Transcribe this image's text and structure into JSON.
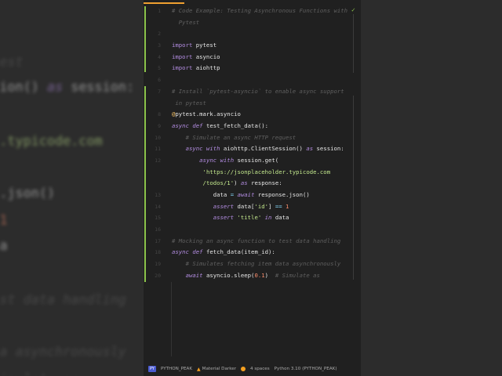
{
  "editor": {
    "lines": [
      {
        "n": "1",
        "t": [
          [
            "# Code Example: Testing Asynchronous Functions with",
            "c"
          ]
        ]
      },
      {
        "n": "",
        "t": [
          [
            "  Pytest",
            "c"
          ]
        ]
      },
      {
        "n": "2",
        "t": []
      },
      {
        "n": "3",
        "t": [
          [
            "import",
            "kw"
          ],
          [
            " pytest",
            ""
          ]
        ]
      },
      {
        "n": "4",
        "t": [
          [
            "import",
            "kw"
          ],
          [
            " asyncio",
            ""
          ]
        ]
      },
      {
        "n": "5",
        "t": [
          [
            "import",
            "kw"
          ],
          [
            " aiohttp",
            ""
          ]
        ]
      },
      {
        "n": "6",
        "t": []
      },
      {
        "n": "7",
        "t": [
          [
            "# Install `pytest-asyncio` to enable async support",
            "c"
          ]
        ]
      },
      {
        "n": "",
        "t": [
          [
            " in pytest",
            "c"
          ]
        ]
      },
      {
        "n": "8",
        "t": [
          [
            "@",
            "d"
          ],
          [
            "pytest.mark.asyncio",
            ""
          ]
        ]
      },
      {
        "n": "9",
        "t": [
          [
            "async def",
            "k"
          ],
          [
            " test_fetch_data():",
            ""
          ]
        ]
      },
      {
        "n": "10",
        "t": [
          [
            "    # Simulate an async HTTP request",
            "c"
          ]
        ]
      },
      {
        "n": "11",
        "t": [
          [
            "    ",
            ""
          ],
          [
            "async with",
            "k"
          ],
          [
            " aiohttp.ClientSession() ",
            ""
          ],
          [
            "as",
            "k"
          ],
          [
            " session:",
            ""
          ]
        ]
      },
      {
        "n": "12",
        "t": [
          [
            "        ",
            ""
          ],
          [
            "async with",
            "k"
          ],
          [
            " session.get(",
            ""
          ]
        ]
      },
      {
        "n": "",
        "t": [
          [
            "         ",
            ""
          ],
          [
            "'https://jsonplaceholder.typicode.com",
            "s"
          ]
        ]
      },
      {
        "n": "",
        "t": [
          [
            "         ",
            ""
          ],
          [
            "/todos/1'",
            "s"
          ],
          [
            ") ",
            ""
          ],
          [
            "as",
            "k"
          ],
          [
            " response:",
            ""
          ]
        ]
      },
      {
        "n": "13",
        "t": [
          [
            "            data ",
            ""
          ],
          [
            "=",
            "p"
          ],
          [
            " ",
            ""
          ],
          [
            "await",
            "k"
          ],
          [
            " response.json()",
            ""
          ]
        ]
      },
      {
        "n": "14",
        "t": [
          [
            "            ",
            ""
          ],
          [
            "assert",
            "k"
          ],
          [
            " data[",
            ""
          ],
          [
            "'id'",
            "s"
          ],
          [
            "] ",
            ""
          ],
          [
            "==",
            "p"
          ],
          [
            " ",
            ""
          ],
          [
            "1",
            "n"
          ]
        ]
      },
      {
        "n": "15",
        "t": [
          [
            "            ",
            ""
          ],
          [
            "assert",
            "k"
          ],
          [
            " ",
            ""
          ],
          [
            "'title'",
            "s"
          ],
          [
            " ",
            ""
          ],
          [
            "in",
            "k"
          ],
          [
            " data",
            ""
          ]
        ]
      },
      {
        "n": "16",
        "t": []
      },
      {
        "n": "17",
        "t": [
          [
            "# Mocking an async function to test data handling",
            "c"
          ]
        ]
      },
      {
        "n": "18",
        "t": [
          [
            "async def",
            "k"
          ],
          [
            " fetch_data(item_id):",
            ""
          ]
        ]
      },
      {
        "n": "19",
        "t": [
          [
            "    # Simulates fetching item data asynchronously",
            "c"
          ]
        ]
      },
      {
        "n": "20",
        "t": [
          [
            "    ",
            ""
          ],
          [
            "await",
            "k"
          ],
          [
            " asyncio.sleep(",
            ""
          ],
          [
            "0.1",
            "n"
          ],
          [
            ")  ",
            ""
          ],
          [
            "# Simulate as",
            "c"
          ]
        ]
      }
    ]
  },
  "status": {
    "project_badge": "PY",
    "project": "PYTHON_PEAK",
    "theme": "Material Darker",
    "indent": "4 spaces",
    "interpreter": "Python 3.10 (PYTHON_PEAK)"
  },
  "colors": {
    "accent": "#f0a030",
    "vcs_added": "#8bc34a"
  }
}
